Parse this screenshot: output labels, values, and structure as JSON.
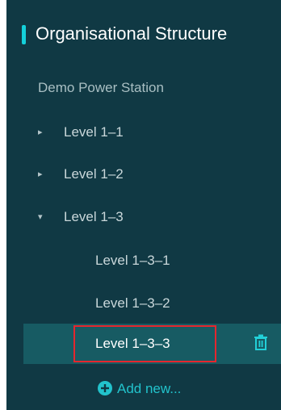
{
  "colors": {
    "panel_bg": "#103944",
    "accent": "#14d0da",
    "selected_bg": "#175b63",
    "highlight": "#e6262e",
    "add_new": "#22c3cc"
  },
  "header": {
    "title": "Organisational Structure"
  },
  "tree": {
    "root_label": "Demo Power Station",
    "nodes": [
      {
        "label": "Level 1–1",
        "caret": "▸",
        "expanded": false
      },
      {
        "label": "Level 1–2",
        "caret": "▸",
        "expanded": false
      },
      {
        "label": "Level 1–3",
        "caret": "▾",
        "expanded": true
      }
    ],
    "children": [
      {
        "label": "Level 1–3–1"
      },
      {
        "label": "Level 1–3–2"
      },
      {
        "label": "Level 1–3–3",
        "selected": true,
        "icon": "trash-icon"
      }
    ]
  },
  "add_new": {
    "label": "Add new...",
    "icon": "plus-circle-icon"
  }
}
